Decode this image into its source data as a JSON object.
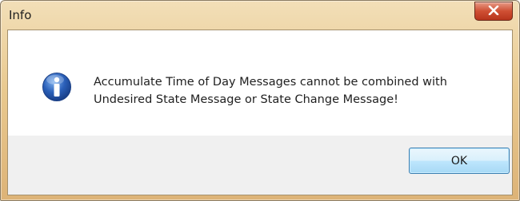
{
  "window": {
    "title": "Info",
    "close_icon": "close-icon"
  },
  "dialog": {
    "icon": "info-icon",
    "message_line1": "Accumulate Time of Day Messages cannot be combined with",
    "message_line2": "Undesired State Message or State Change Message!",
    "ok_label": "OK"
  },
  "colors": {
    "frame": "#e9c98f",
    "close_button": "#cf4f33",
    "ok_border": "#3c7fb1",
    "info_icon": "#2a5fb8"
  }
}
